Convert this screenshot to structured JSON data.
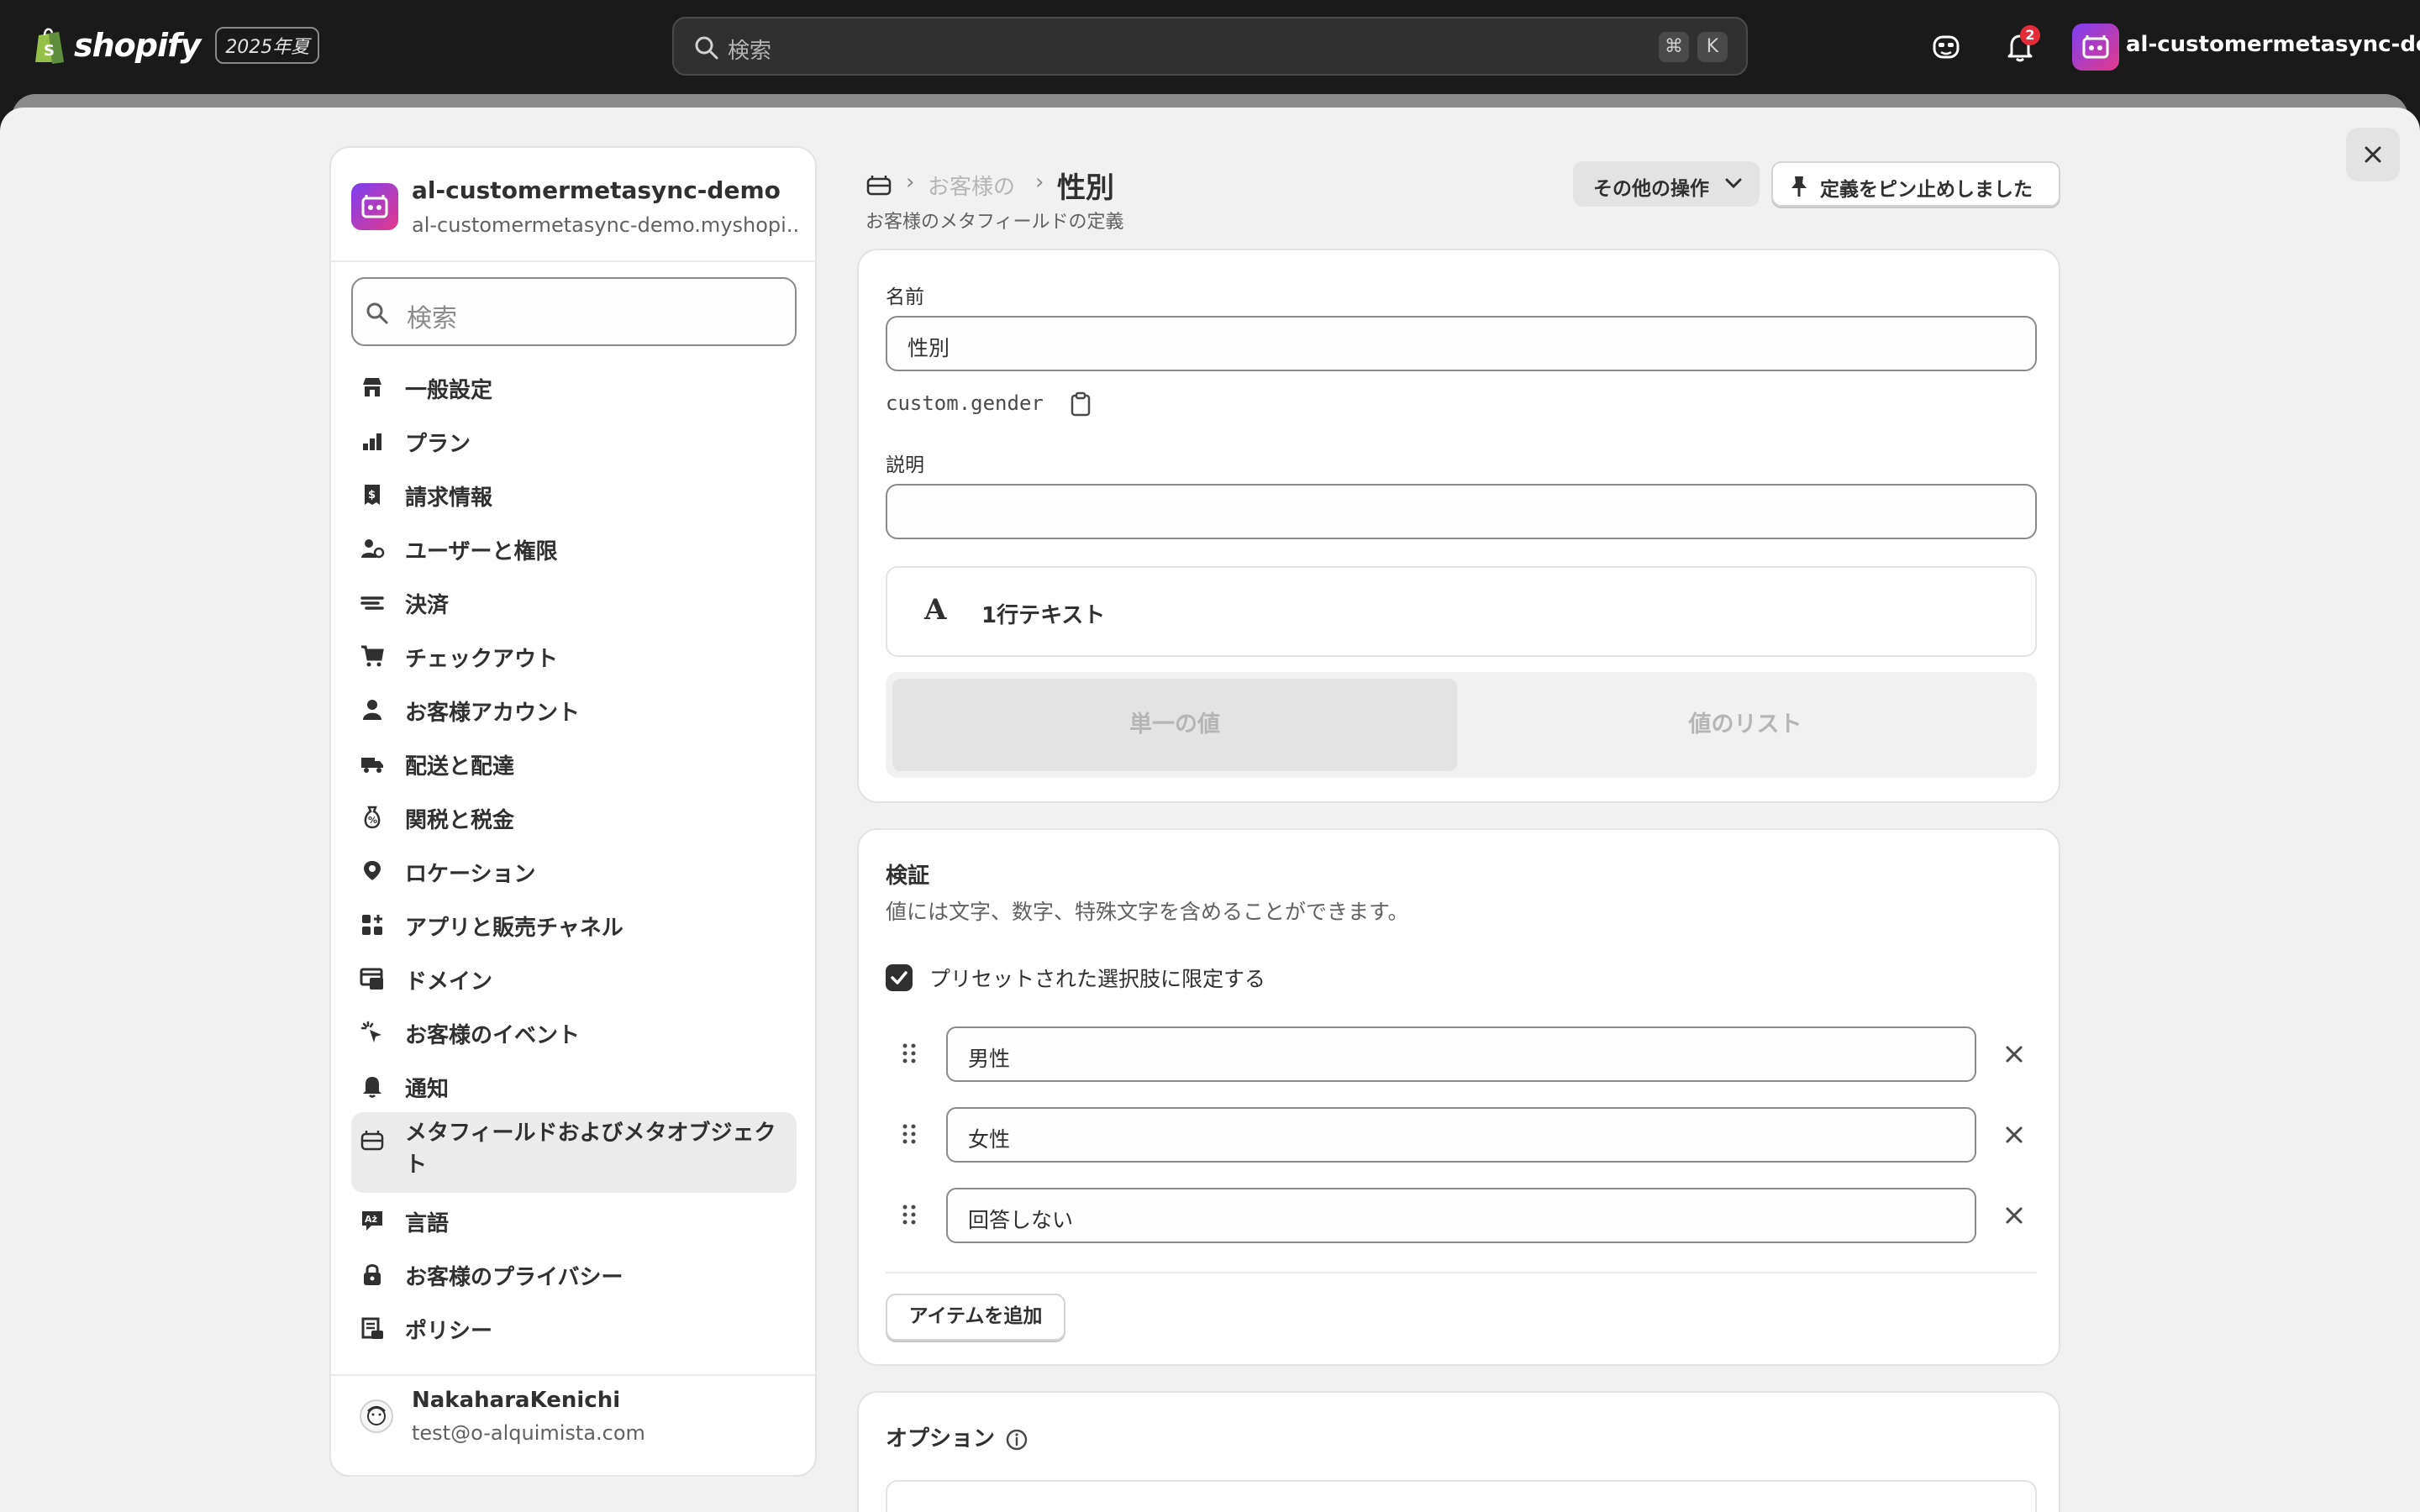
{
  "topbar": {
    "brand": "shopify",
    "edition": "2025年夏",
    "search_placeholder": "検索",
    "kbd_cmd": "⌘",
    "kbd_k": "K",
    "notification_count": "2",
    "store_name": "al-customermetasync-de..."
  },
  "sidebar": {
    "store_name": "al-customermetasync-demo",
    "store_domain": "al-customermetasync-demo.myshopi...",
    "search_placeholder": "検索",
    "items": [
      {
        "label": "一般設定",
        "icon": "store-icon"
      },
      {
        "label": "プラン",
        "icon": "plan-icon"
      },
      {
        "label": "請求情報",
        "icon": "billing-icon"
      },
      {
        "label": "ユーザーと権限",
        "icon": "users-icon"
      },
      {
        "label": "決済",
        "icon": "payments-icon"
      },
      {
        "label": "チェックアウト",
        "icon": "cart-icon"
      },
      {
        "label": "お客様アカウント",
        "icon": "person-icon"
      },
      {
        "label": "配送と配達",
        "icon": "truck-icon"
      },
      {
        "label": "関税と税金",
        "icon": "tax-icon"
      },
      {
        "label": "ロケーション",
        "icon": "location-icon"
      },
      {
        "label": "アプリと販売チャネル",
        "icon": "apps-icon"
      },
      {
        "label": "ドメイン",
        "icon": "domain-icon"
      },
      {
        "label": "お客様のイベント",
        "icon": "events-icon"
      },
      {
        "label": "通知",
        "icon": "bell-icon"
      },
      {
        "label": "メタフィールドおよびメタオブジェクト",
        "icon": "metafields-icon",
        "active": true
      },
      {
        "label": "言語",
        "icon": "language-icon"
      },
      {
        "label": "お客様のプライバシー",
        "icon": "lock-icon"
      },
      {
        "label": "ポリシー",
        "icon": "policy-icon"
      }
    ],
    "user_name": "NakaharaKenichi",
    "user_email": "test@o-alquimista.com"
  },
  "header": {
    "breadcrumb_sep": "›",
    "breadcrumb": "お客様の",
    "title": "性別",
    "subtitle": "お客様のメタフィールドの定義",
    "more_actions": "その他の操作",
    "pinned": "定義をピン止めしました"
  },
  "definition": {
    "name_label": "名前",
    "name_value": "性別",
    "key": "custom.gender",
    "description_label": "説明",
    "description_value": "",
    "type_glyph": "A",
    "type_label": "1行テキスト",
    "single_value": "単一の値",
    "list_value": "値のリスト"
  },
  "validation": {
    "title": "検証",
    "help": "値には文字、数字、特殊文字を含めることができます。",
    "limit_label": "プリセットされた選択肢に限定する",
    "limit_checked": true,
    "choices": [
      "男性",
      "女性",
      "回答しない"
    ],
    "add_item": "アイテムを追加"
  },
  "options": {
    "title": "オプション"
  },
  "colors": {
    "topbar": "#1a1a1a",
    "page_bg": "#f1f1f1",
    "card_bg": "#ffffff",
    "text": "#303030",
    "muted": "#616161",
    "badge": "#e22c38"
  }
}
